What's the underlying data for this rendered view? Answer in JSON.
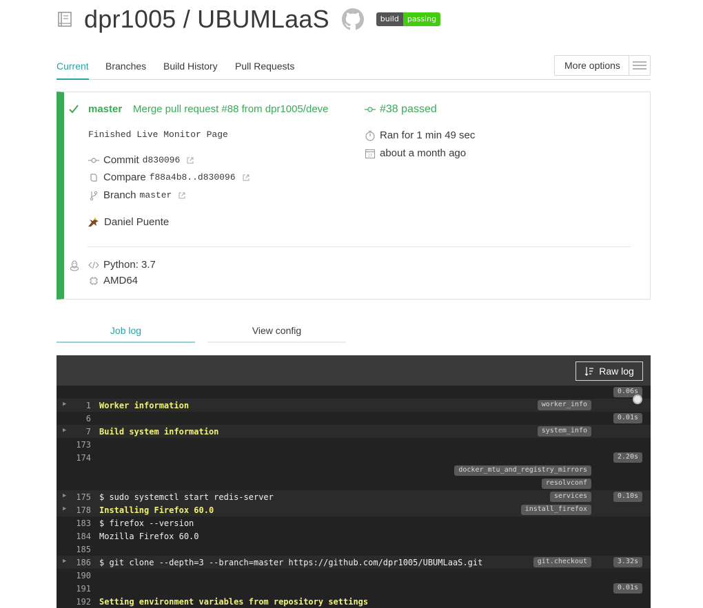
{
  "repo": {
    "owner_slash_name": "dpr1005 / UBUMLaaS",
    "badge_left": "build",
    "badge_right": "passing"
  },
  "tabs": [
    {
      "label": "Current",
      "active": true
    },
    {
      "label": "Branches"
    },
    {
      "label": "Build History"
    },
    {
      "label": "Pull Requests"
    }
  ],
  "more_options": "More options",
  "build": {
    "branch": "master",
    "commit_message": "Merge pull request #88 from dpr1005/deve",
    "description": "Finished Live Monitor Page",
    "commit_label": "Commit",
    "commit_sha": "d830096",
    "compare_label": "Compare",
    "compare_range": "f88a4b8..d830096",
    "branch_label": "Branch",
    "branch_value": "master",
    "author": "Daniel Puente",
    "build_status": "#38 passed",
    "duration": "Ran for 1 min 49 sec",
    "finished": "about a month ago",
    "language": "Python: 3.7",
    "arch": "AMD64",
    "accent_color": "#39aa56"
  },
  "log_tabs": {
    "job_log": "Job log",
    "view_config": "View config"
  },
  "log": {
    "raw_log_label": "Raw log",
    "lines": [
      {
        "num": "",
        "text": "",
        "dur": "0.06s"
      },
      {
        "num": "1",
        "text": "Worker information",
        "bold": true,
        "fold": true,
        "tag": "worker_info"
      },
      {
        "num": "6",
        "text": "",
        "dur": "0.01s"
      },
      {
        "num": "7",
        "text": "Build system information",
        "bold": true,
        "fold": true,
        "tag": "system_info"
      },
      {
        "num": "173",
        "text": ""
      },
      {
        "num": "174",
        "text": "",
        "dur": "2.20s"
      },
      {
        "num": "",
        "text": "",
        "tag": "docker_mtu_and_registry_mirrors"
      },
      {
        "num": "",
        "text": "",
        "tag": "resolvconf"
      },
      {
        "num": "175",
        "text": "$ sudo systemctl start redis-server",
        "fold": true,
        "tag": "services",
        "dur": "0.10s"
      },
      {
        "num": "178",
        "text": "Installing Firefox 60.0",
        "bold": true,
        "fold": true,
        "tag": "install_firefox"
      },
      {
        "num": "183",
        "text": "$ firefox --version"
      },
      {
        "num": "184",
        "text": "Mozilla Firefox 60.0"
      },
      {
        "num": "185",
        "text": ""
      },
      {
        "num": "186",
        "text": "$ git clone --depth=3 --branch=master https://github.com/dpr1005/UBUMLaaS.git",
        "fold": true,
        "tag": "git.checkout",
        "dur": "3.32s"
      },
      {
        "num": "190",
        "text": ""
      },
      {
        "num": "191",
        "text": "",
        "dur": "0.01s"
      },
      {
        "num": "192",
        "text": "Setting environment variables from repository settings",
        "bold": true
      }
    ]
  }
}
